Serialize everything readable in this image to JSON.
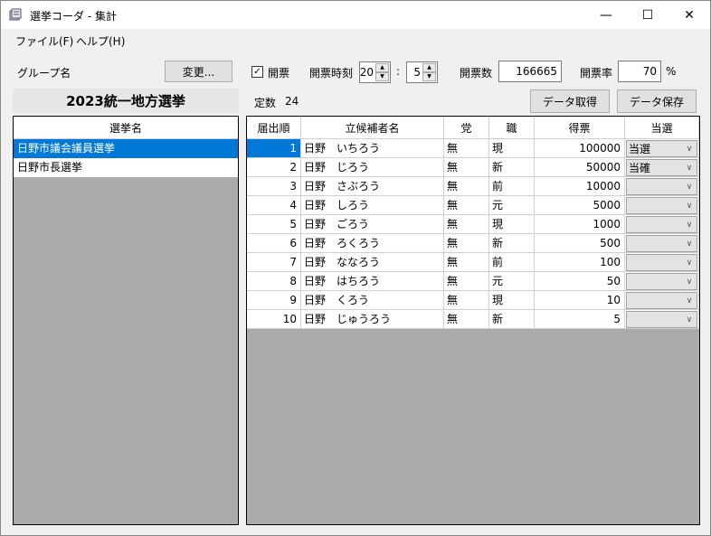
{
  "window": {
    "title": "選挙コーダ - 集計",
    "min": "—",
    "max": "☐",
    "close": "✕"
  },
  "menu": [
    "ファイル(F)",
    "ヘルプ(H)"
  ],
  "toolbar": {
    "group_label": "グループ名",
    "change_button": "変更...",
    "kaihyo_label": "開票",
    "kaihyo_checked": true,
    "time_label": "開票時刻",
    "hour": "20",
    "colon": ":",
    "minute": "5",
    "count_label": "開票数",
    "count_value": "166665",
    "rate_label": "開票率",
    "rate_value": "70",
    "rate_unit": "%"
  },
  "group_title": "2023統一地方選挙",
  "seats": {
    "label": "定数",
    "value": "24"
  },
  "buttons": {
    "fetch": "データ取得",
    "save": "データ保存"
  },
  "election_list": {
    "header": "選挙名",
    "items": [
      {
        "name": "日野市議会議員選挙",
        "selected": true
      },
      {
        "name": "日野市長選挙",
        "selected": false
      }
    ]
  },
  "grid": {
    "headers": [
      "届出順",
      "立候補者名",
      "党",
      "職",
      "得票",
      "当選"
    ],
    "rows": [
      {
        "no": "1",
        "name": "日野　いちろう",
        "party": "無",
        "status": "現",
        "votes": "100000",
        "result": "当選"
      },
      {
        "no": "2",
        "name": "日野　じろう",
        "party": "無",
        "status": "新",
        "votes": "50000",
        "result": "当確"
      },
      {
        "no": "3",
        "name": "日野　さぶろう",
        "party": "無",
        "status": "前",
        "votes": "10000",
        "result": ""
      },
      {
        "no": "4",
        "name": "日野　しろう",
        "party": "無",
        "status": "元",
        "votes": "5000",
        "result": ""
      },
      {
        "no": "5",
        "name": "日野　ごろう",
        "party": "無",
        "status": "現",
        "votes": "1000",
        "result": ""
      },
      {
        "no": "6",
        "name": "日野　ろくろう",
        "party": "無",
        "status": "新",
        "votes": "500",
        "result": ""
      },
      {
        "no": "7",
        "name": "日野　ななろう",
        "party": "無",
        "status": "前",
        "votes": "100",
        "result": ""
      },
      {
        "no": "8",
        "name": "日野　はちろう",
        "party": "無",
        "status": "元",
        "votes": "50",
        "result": ""
      },
      {
        "no": "9",
        "name": "日野　くろう",
        "party": "無",
        "status": "現",
        "votes": "10",
        "result": ""
      },
      {
        "no": "10",
        "name": "日野　じゅうろう",
        "party": "無",
        "status": "新",
        "votes": "5",
        "result": ""
      }
    ]
  },
  "colors": {
    "selection": "#0078d7",
    "empty_area": "#ababab"
  }
}
